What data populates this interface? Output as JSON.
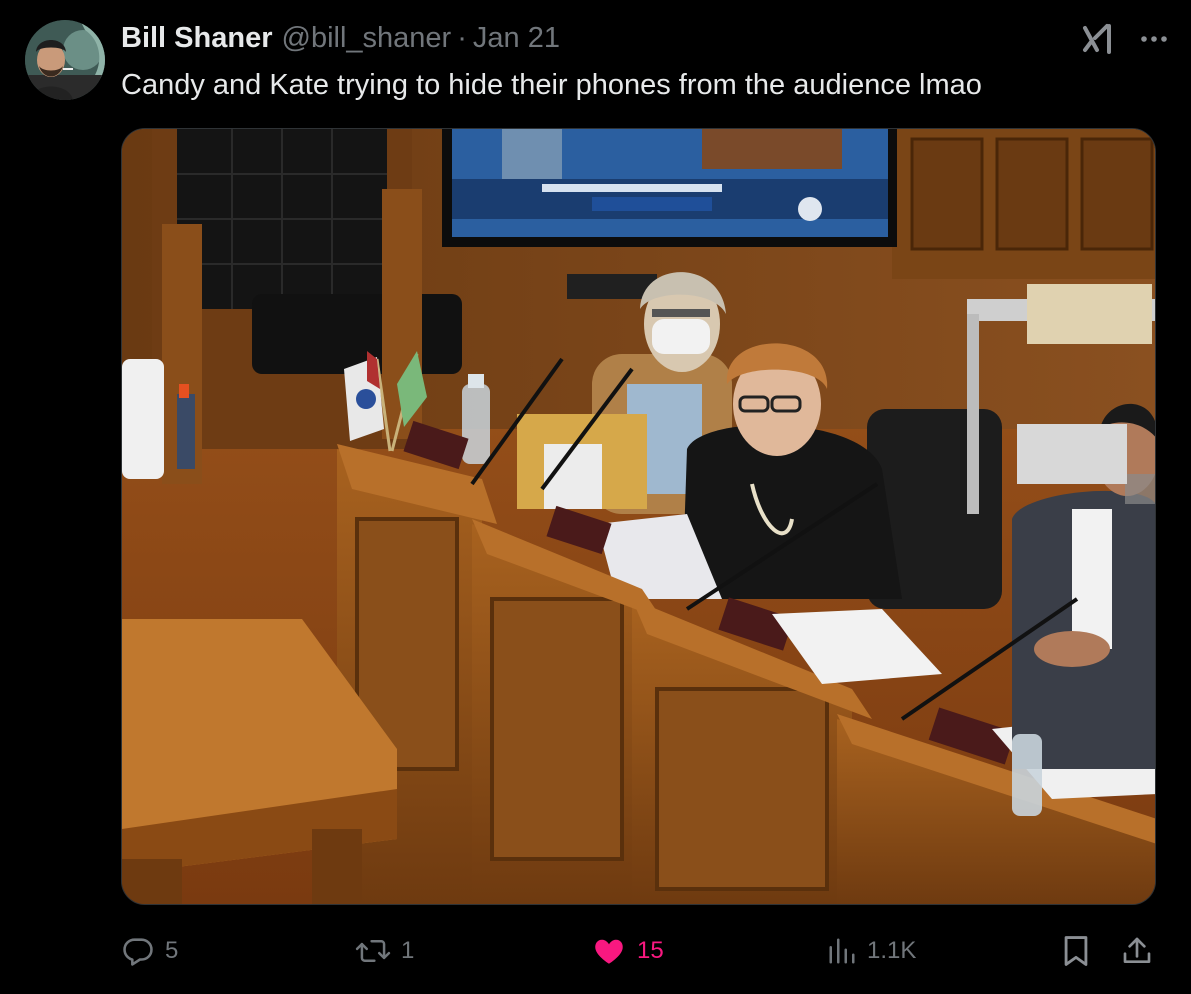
{
  "author": {
    "name": "Bill Shaner",
    "handle": "@bill_shaner",
    "separator": "·",
    "date": "Jan 21"
  },
  "tweet": {
    "text": "Candy and Kate trying to hide their phones from the audience lmao"
  },
  "actions": {
    "replies": "5",
    "reposts": "1",
    "likes": "15",
    "views": "1.1K",
    "liked": true
  },
  "icons": {
    "grok": "grok-icon",
    "more": "more-horizontal-icon",
    "reply": "reply-icon",
    "repost": "repost-icon",
    "like": "heart-filled-icon",
    "views": "views-bar-chart-icon",
    "bookmark": "bookmark-icon",
    "share": "share-icon"
  },
  "colors": {
    "background": "#000000",
    "text_primary": "#e7e9ea",
    "text_secondary": "#71767b",
    "like": "#f91880"
  }
}
